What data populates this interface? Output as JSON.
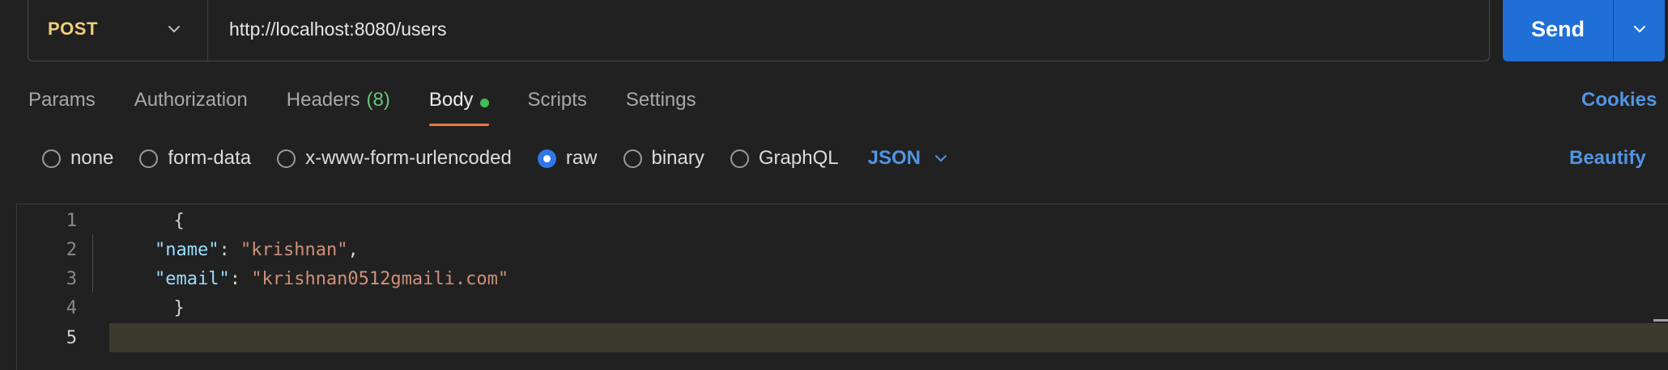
{
  "request": {
    "method": "POST",
    "url": "http://localhost:8080/users",
    "send_label": "Send"
  },
  "tabs": [
    {
      "label": "Params"
    },
    {
      "label": "Authorization"
    },
    {
      "label": "Headers",
      "count": "(8)"
    },
    {
      "label": "Body"
    },
    {
      "label": "Scripts"
    },
    {
      "label": "Settings"
    }
  ],
  "active_tab": "Body",
  "cookies_label": "Cookies",
  "body_types": [
    {
      "label": "none",
      "checked": false
    },
    {
      "label": "form-data",
      "checked": false
    },
    {
      "label": "x-www-form-urlencoded",
      "checked": false
    },
    {
      "label": "raw",
      "checked": true
    },
    {
      "label": "binary",
      "checked": false
    },
    {
      "label": "GraphQL",
      "checked": false
    }
  ],
  "language": "JSON",
  "beautify_label": "Beautify",
  "editor": {
    "line_numbers": [
      "1",
      "2",
      "3",
      "4",
      "5"
    ],
    "lines": {
      "l1": "{",
      "l2_key": "\"name\"",
      "l2_sep": ": ",
      "l2_val": "\"krishnan\"",
      "l2_end": ",",
      "l3_key": "\"email\"",
      "l3_sep": ": ",
      "l3_val": "\"krishnan0512gmaili.com\"",
      "l4": "}"
    },
    "current_line": "5"
  },
  "colors": {
    "accent_blue": "#1f6fd6",
    "method_color": "#f0cf7a",
    "active_tab_underline": "#e87a42",
    "body_dot": "#3ebd5a"
  }
}
